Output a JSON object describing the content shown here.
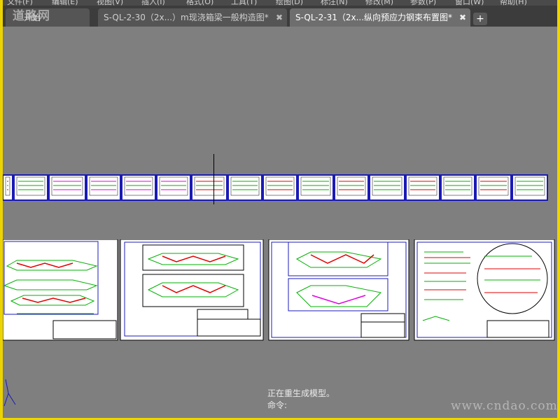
{
  "menubar": {
    "items": [
      "文件(F)",
      "编辑(E)",
      "视图(V)",
      "插入(I)",
      "格式(O)",
      "工具(T)",
      "绘图(D)",
      "标注(N)",
      "修改(M)",
      "参数(P)",
      "窗口(W)",
      "帮助(H)"
    ]
  },
  "tabs": [
    {
      "label": "开始",
      "active": false
    },
    {
      "label": "S-QL-2-30（2x...）m现浇箱梁一般构造图*",
      "active": false
    },
    {
      "label": "S-QL-2-31（2x...纵向预应力钢束布置图*",
      "active": true
    }
  ],
  "new_tab": "+",
  "tab_close": "✖",
  "watermark_top": "道路网",
  "command_line": {
    "message": "正在重生成模型。",
    "prompt": "命令:"
  },
  "watermark_bottom": "www.cndao.com",
  "colors": {
    "canvas": "#7f7f7f",
    "border": "#ecd400",
    "sheet_frame": "#1a1ab8",
    "rebar_green": "#00b000",
    "tendon_red": "#e00000",
    "highlight_magenta": "#e000e0"
  }
}
